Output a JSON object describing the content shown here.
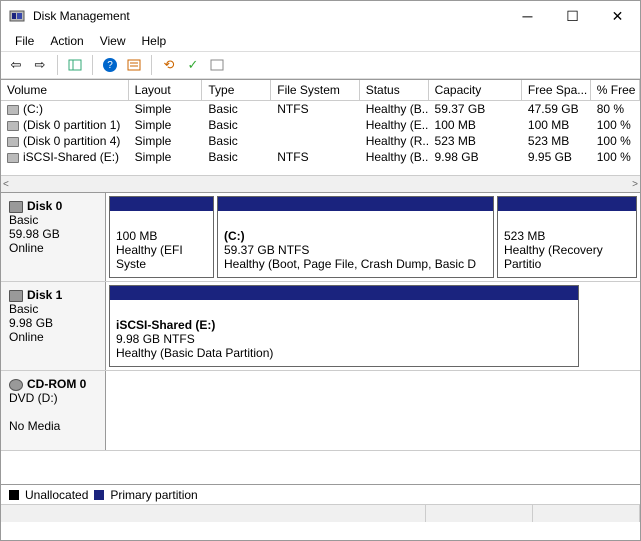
{
  "title": "Disk Management",
  "menu": {
    "file": "File",
    "action": "Action",
    "view": "View",
    "help": "Help"
  },
  "columns": {
    "vol": "Volume",
    "layout": "Layout",
    "type": "Type",
    "fs": "File System",
    "status": "Status",
    "cap": "Capacity",
    "free": "Free Spa...",
    "pct": "% Free"
  },
  "volumes": [
    {
      "name": "(C:)",
      "layout": "Simple",
      "type": "Basic",
      "fs": "NTFS",
      "status": "Healthy (B...",
      "cap": "59.37 GB",
      "free": "47.59 GB",
      "pct": "80 %"
    },
    {
      "name": "(Disk 0 partition 1)",
      "layout": "Simple",
      "type": "Basic",
      "fs": "",
      "status": "Healthy (E...",
      "cap": "100 MB",
      "free": "100 MB",
      "pct": "100 %"
    },
    {
      "name": "(Disk 0 partition 4)",
      "layout": "Simple",
      "type": "Basic",
      "fs": "",
      "status": "Healthy (R...",
      "cap": "523 MB",
      "free": "523 MB",
      "pct": "100 %"
    },
    {
      "name": "iSCSI-Shared (E:)",
      "layout": "Simple",
      "type": "Basic",
      "fs": "NTFS",
      "status": "Healthy (B...",
      "cap": "9.98 GB",
      "free": "9.95 GB",
      "pct": "100 %"
    }
  ],
  "disks": {
    "d0": {
      "name": "Disk 0",
      "type": "Basic",
      "size": "59.98 GB",
      "status": "Online"
    },
    "d1": {
      "name": "Disk 1",
      "type": "Basic",
      "size": "9.98 GB",
      "status": "Online"
    },
    "cd": {
      "name": "CD-ROM 0",
      "type": "DVD (D:)",
      "status": "No Media"
    }
  },
  "parts": {
    "d0p1": {
      "l1": "100 MB",
      "l2": "Healthy (EFI Syste"
    },
    "d0p2": {
      "t": "(C:)",
      "l1": "59.37 GB NTFS",
      "l2": "Healthy (Boot, Page File, Crash Dump, Basic D"
    },
    "d0p3": {
      "l1": "523 MB",
      "l2": "Healthy (Recovery Partitio"
    },
    "d1p1": {
      "t": "iSCSI-Shared  (E:)",
      "l1": "9.98 GB NTFS",
      "l2": "Healthy (Basic Data Partition)"
    }
  },
  "legend": {
    "unalloc": "Unallocated",
    "primary": "Primary partition"
  }
}
